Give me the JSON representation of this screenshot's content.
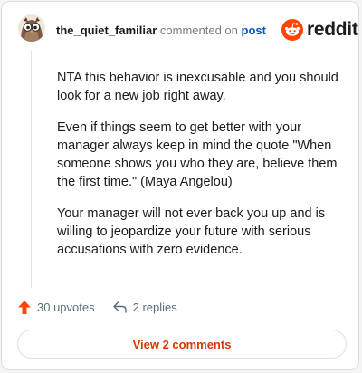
{
  "comment": {
    "username": "the_quiet_familiar",
    "action_text": "commented on",
    "target_text": "post",
    "paragraphs": [
      "NTA this behavior is inexcusable and you should look for a new job right away.",
      "Even if things seem to get better with your manager always keep in mind the quote \"When someone shows you who they are, believe them the first time.\" (Maya Angelou)",
      "Your manager will not ever back you up and is willing to jeopardize your future with serious accusations with zero evidence."
    ],
    "upvotes_label": "30 upvotes",
    "replies_label": "2 replies",
    "view_comments_label": "View 2 comments"
  },
  "brand": {
    "logo_text": "reddit",
    "logo_color": "#ff4500",
    "upvote_color": "#ff4500",
    "view_button_color": "#d93900",
    "link_color": "#0b58c2"
  },
  "icons": {
    "avatar": "avatar-owl-icon",
    "logo": "reddit-snoo-icon",
    "upvote": "upvote-arrow-icon",
    "reply": "reply-arrow-icon"
  }
}
